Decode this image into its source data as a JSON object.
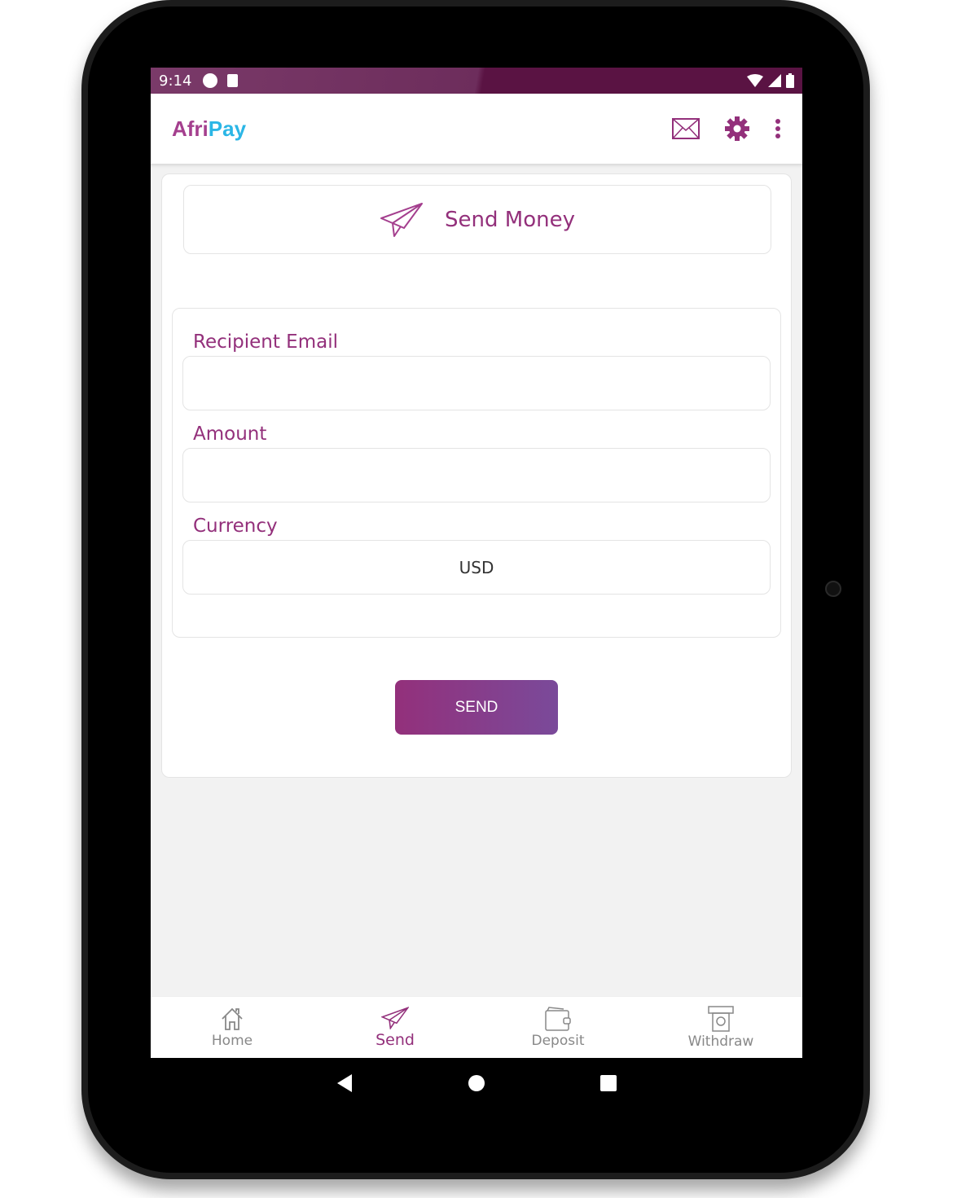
{
  "status_bar": {
    "time": "9:14",
    "icons": [
      "data-saver-icon",
      "sd-card-icon",
      "wifi-icon",
      "signal-icon",
      "battery-icon"
    ]
  },
  "app_bar": {
    "logo_part1": "Afri",
    "logo_part2": "Pay",
    "actions": [
      "mail-icon",
      "settings-gear-icon",
      "more-vert-icon"
    ]
  },
  "colors": {
    "primary": "#93307b",
    "logo_accent": "#2bb6e6",
    "status_bar": "#5a1343"
  },
  "header": {
    "title": "Send Money",
    "icon": "paper-plane-icon"
  },
  "form": {
    "recipient_label": "Recipient Email",
    "recipient_value": "",
    "amount_label": "Amount",
    "amount_value": "",
    "currency_label": "Currency",
    "currency_value": "USD"
  },
  "send_button": "SEND",
  "bottom_nav": [
    {
      "label": "Home",
      "icon": "home-icon"
    },
    {
      "label": "Send",
      "icon": "paper-plane-icon",
      "active": true
    },
    {
      "label": "Deposit",
      "icon": "wallet-icon"
    },
    {
      "label": "Withdraw",
      "icon": "atm-cash-icon"
    }
  ],
  "system_nav": [
    "back-icon",
    "home-circle-icon",
    "recents-icon"
  ]
}
